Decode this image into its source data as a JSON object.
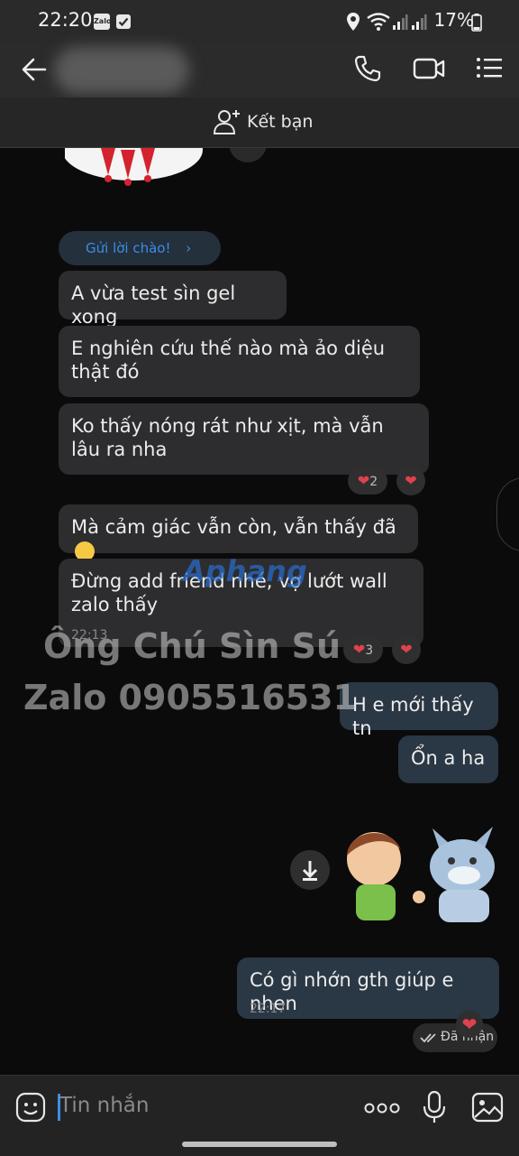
{
  "status_bar": {
    "time": "22:20",
    "app_badge": "Zalo",
    "battery": "17%"
  },
  "header": {
    "add_friend_label": "Kết bạn"
  },
  "chat": {
    "greeting_label": "Gửi lời chào!",
    "messages": [
      {
        "text": "A vừa test sìn gel xong"
      },
      {
        "text": "E nghiên cứu thế nào mà ảo diệu thật đó"
      },
      {
        "text": "Ko thấy nóng rát như xịt, mà vẫn lâu ra nha",
        "reaction_count": "2"
      },
      {
        "text": "Mà cảm giác vẫn còn, vẫn thấy đã"
      },
      {
        "text": "Đừng add friend nhé, vợ lướt wall zalo thấy",
        "time": "22:13",
        "reaction_count": "3"
      },
      {
        "text": "H e mới thấy tn"
      },
      {
        "text": "Ổn a ha"
      },
      {
        "text": "Có gì nhớn gth giúp e nhen",
        "time": "22:17",
        "status": "Đã nhận"
      }
    ],
    "watermark_line1": "Ông Chú Sìn Sú",
    "watermark_line2": "Zalo 0905516531",
    "logo_watermark": "Aphang"
  },
  "composer": {
    "placeholder": "Tin nhắn"
  },
  "colors": {
    "accent": "#3a8ee6",
    "heart": "#e0424d",
    "bubble_other": "#2d2d2f",
    "bubble_me": "#2a3744"
  }
}
